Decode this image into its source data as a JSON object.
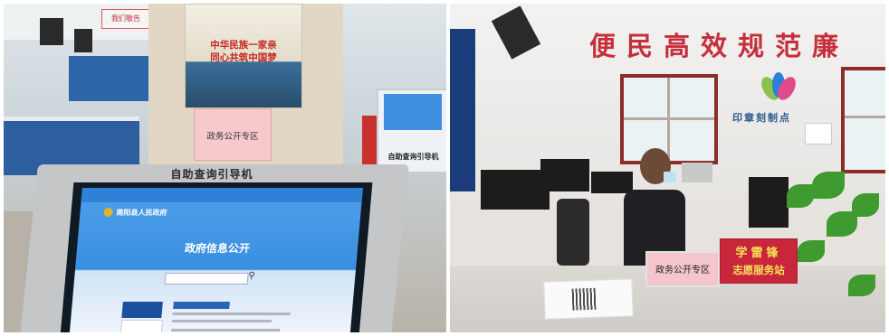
{
  "left_photo": {
    "top_sign": "我们敬告",
    "poster_line1": "中华民族一家亲",
    "poster_line2": "同心共筑中国梦",
    "pink_card_label": "政务公开专区",
    "kiosk_title": "自助查询引导机",
    "right_kiosk_label": "自助查询引导机",
    "screen": {
      "site_name": "南阳县人民政府",
      "page_heading": "政府信息公开",
      "search_icon": "magnifier-icon"
    }
  },
  "right_photo": {
    "wall_banner": "便民高效规范廉",
    "stamp_service_label": "印章刻制点",
    "pink_sign_label": "政务公开专区",
    "red_sign_line1": "学雷锋",
    "red_sign_line2": "志愿服务站",
    "colors": {
      "banner_red": "#c62f3a",
      "sign_red": "#c8263a",
      "sign_yellow": "#f7e25a"
    }
  }
}
